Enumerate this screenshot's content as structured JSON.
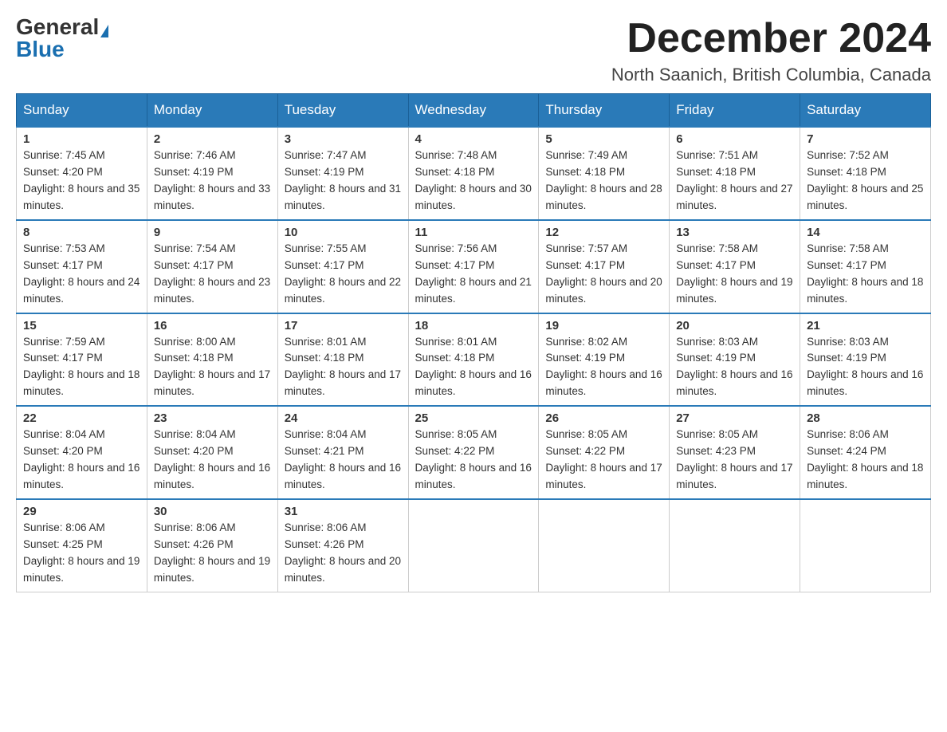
{
  "logo": {
    "general": "General",
    "blue": "Blue"
  },
  "title": "December 2024",
  "location": "North Saanich, British Columbia, Canada",
  "days_of_week": [
    "Sunday",
    "Monday",
    "Tuesday",
    "Wednesday",
    "Thursday",
    "Friday",
    "Saturday"
  ],
  "weeks": [
    [
      {
        "day": "1",
        "sunrise": "7:45 AM",
        "sunset": "4:20 PM",
        "daylight": "8 hours and 35 minutes."
      },
      {
        "day": "2",
        "sunrise": "7:46 AM",
        "sunset": "4:19 PM",
        "daylight": "8 hours and 33 minutes."
      },
      {
        "day": "3",
        "sunrise": "7:47 AM",
        "sunset": "4:19 PM",
        "daylight": "8 hours and 31 minutes."
      },
      {
        "day": "4",
        "sunrise": "7:48 AM",
        "sunset": "4:18 PM",
        "daylight": "8 hours and 30 minutes."
      },
      {
        "day": "5",
        "sunrise": "7:49 AM",
        "sunset": "4:18 PM",
        "daylight": "8 hours and 28 minutes."
      },
      {
        "day": "6",
        "sunrise": "7:51 AM",
        "sunset": "4:18 PM",
        "daylight": "8 hours and 27 minutes."
      },
      {
        "day": "7",
        "sunrise": "7:52 AM",
        "sunset": "4:18 PM",
        "daylight": "8 hours and 25 minutes."
      }
    ],
    [
      {
        "day": "8",
        "sunrise": "7:53 AM",
        "sunset": "4:17 PM",
        "daylight": "8 hours and 24 minutes."
      },
      {
        "day": "9",
        "sunrise": "7:54 AM",
        "sunset": "4:17 PM",
        "daylight": "8 hours and 23 minutes."
      },
      {
        "day": "10",
        "sunrise": "7:55 AM",
        "sunset": "4:17 PM",
        "daylight": "8 hours and 22 minutes."
      },
      {
        "day": "11",
        "sunrise": "7:56 AM",
        "sunset": "4:17 PM",
        "daylight": "8 hours and 21 minutes."
      },
      {
        "day": "12",
        "sunrise": "7:57 AM",
        "sunset": "4:17 PM",
        "daylight": "8 hours and 20 minutes."
      },
      {
        "day": "13",
        "sunrise": "7:58 AM",
        "sunset": "4:17 PM",
        "daylight": "8 hours and 19 minutes."
      },
      {
        "day": "14",
        "sunrise": "7:58 AM",
        "sunset": "4:17 PM",
        "daylight": "8 hours and 18 minutes."
      }
    ],
    [
      {
        "day": "15",
        "sunrise": "7:59 AM",
        "sunset": "4:17 PM",
        "daylight": "8 hours and 18 minutes."
      },
      {
        "day": "16",
        "sunrise": "8:00 AM",
        "sunset": "4:18 PM",
        "daylight": "8 hours and 17 minutes."
      },
      {
        "day": "17",
        "sunrise": "8:01 AM",
        "sunset": "4:18 PM",
        "daylight": "8 hours and 17 minutes."
      },
      {
        "day": "18",
        "sunrise": "8:01 AM",
        "sunset": "4:18 PM",
        "daylight": "8 hours and 16 minutes."
      },
      {
        "day": "19",
        "sunrise": "8:02 AM",
        "sunset": "4:19 PM",
        "daylight": "8 hours and 16 minutes."
      },
      {
        "day": "20",
        "sunrise": "8:03 AM",
        "sunset": "4:19 PM",
        "daylight": "8 hours and 16 minutes."
      },
      {
        "day": "21",
        "sunrise": "8:03 AM",
        "sunset": "4:19 PM",
        "daylight": "8 hours and 16 minutes."
      }
    ],
    [
      {
        "day": "22",
        "sunrise": "8:04 AM",
        "sunset": "4:20 PM",
        "daylight": "8 hours and 16 minutes."
      },
      {
        "day": "23",
        "sunrise": "8:04 AM",
        "sunset": "4:20 PM",
        "daylight": "8 hours and 16 minutes."
      },
      {
        "day": "24",
        "sunrise": "8:04 AM",
        "sunset": "4:21 PM",
        "daylight": "8 hours and 16 minutes."
      },
      {
        "day": "25",
        "sunrise": "8:05 AM",
        "sunset": "4:22 PM",
        "daylight": "8 hours and 16 minutes."
      },
      {
        "day": "26",
        "sunrise": "8:05 AM",
        "sunset": "4:22 PM",
        "daylight": "8 hours and 17 minutes."
      },
      {
        "day": "27",
        "sunrise": "8:05 AM",
        "sunset": "4:23 PM",
        "daylight": "8 hours and 17 minutes."
      },
      {
        "day": "28",
        "sunrise": "8:06 AM",
        "sunset": "4:24 PM",
        "daylight": "8 hours and 18 minutes."
      }
    ],
    [
      {
        "day": "29",
        "sunrise": "8:06 AM",
        "sunset": "4:25 PM",
        "daylight": "8 hours and 19 minutes."
      },
      {
        "day": "30",
        "sunrise": "8:06 AM",
        "sunset": "4:26 PM",
        "daylight": "8 hours and 19 minutes."
      },
      {
        "day": "31",
        "sunrise": "8:06 AM",
        "sunset": "4:26 PM",
        "daylight": "8 hours and 20 minutes."
      },
      null,
      null,
      null,
      null
    ]
  ],
  "labels": {
    "sunrise": "Sunrise:",
    "sunset": "Sunset:",
    "daylight": "Daylight:"
  }
}
